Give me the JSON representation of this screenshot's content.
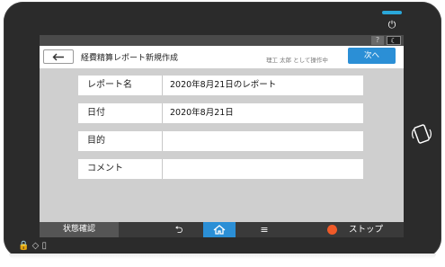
{
  "device": {
    "power_icon": "power-icon",
    "nfc_icon": "nfc-icon",
    "left_icons": "🔒 ◇   ▯"
  },
  "topbar": {
    "help_label": "?",
    "sleep_label": "☾"
  },
  "header": {
    "back_icon": "arrow-left-icon",
    "title": "経費精算レポート新規作成",
    "operator": "理工 太郎 として操作中",
    "next_label": "次へ"
  },
  "form": {
    "rows": [
      {
        "label": "レポート名",
        "value": "2020年8月21日のレポート"
      },
      {
        "label": "日付",
        "value": "2020年8月21日"
      },
      {
        "label": "目的",
        "value": ""
      },
      {
        "label": "コメント",
        "value": ""
      }
    ]
  },
  "bottombar": {
    "status_check": "状態確認",
    "back_glyph": "⮌",
    "home_icon": "home-icon",
    "menu_glyph": "≡",
    "stop_label": "ストップ"
  }
}
